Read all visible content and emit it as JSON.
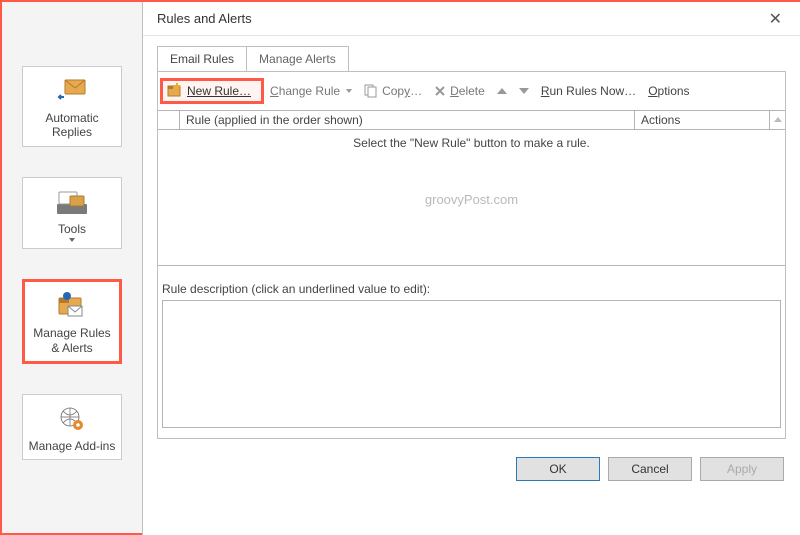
{
  "sidebar": {
    "automatic_replies": "Automatic Replies",
    "tools": "Tools",
    "manage_rules": "Manage Rules & Alerts",
    "manage_addins": "Manage Add-ins"
  },
  "dialog": {
    "title": "Rules and Alerts",
    "tabs": {
      "email_rules": "Email Rules",
      "manage_alerts": "Manage Alerts"
    },
    "toolbar": {
      "new_rule": "New Rule…",
      "change_rule": "Change Rule",
      "copy": "Copy…",
      "delete": "Delete",
      "run_rules_now": "Run Rules Now…",
      "options": "Options"
    },
    "grid": {
      "col_rule": "Rule (applied in the order shown)",
      "col_actions": "Actions",
      "empty_msg": "Select the \"New Rule\" button to make a rule."
    },
    "watermark": "groovyPost.com",
    "desc_label": "Rule description (click an underlined value to edit):",
    "buttons": {
      "ok": "OK",
      "cancel": "Cancel",
      "apply": "Apply"
    }
  }
}
